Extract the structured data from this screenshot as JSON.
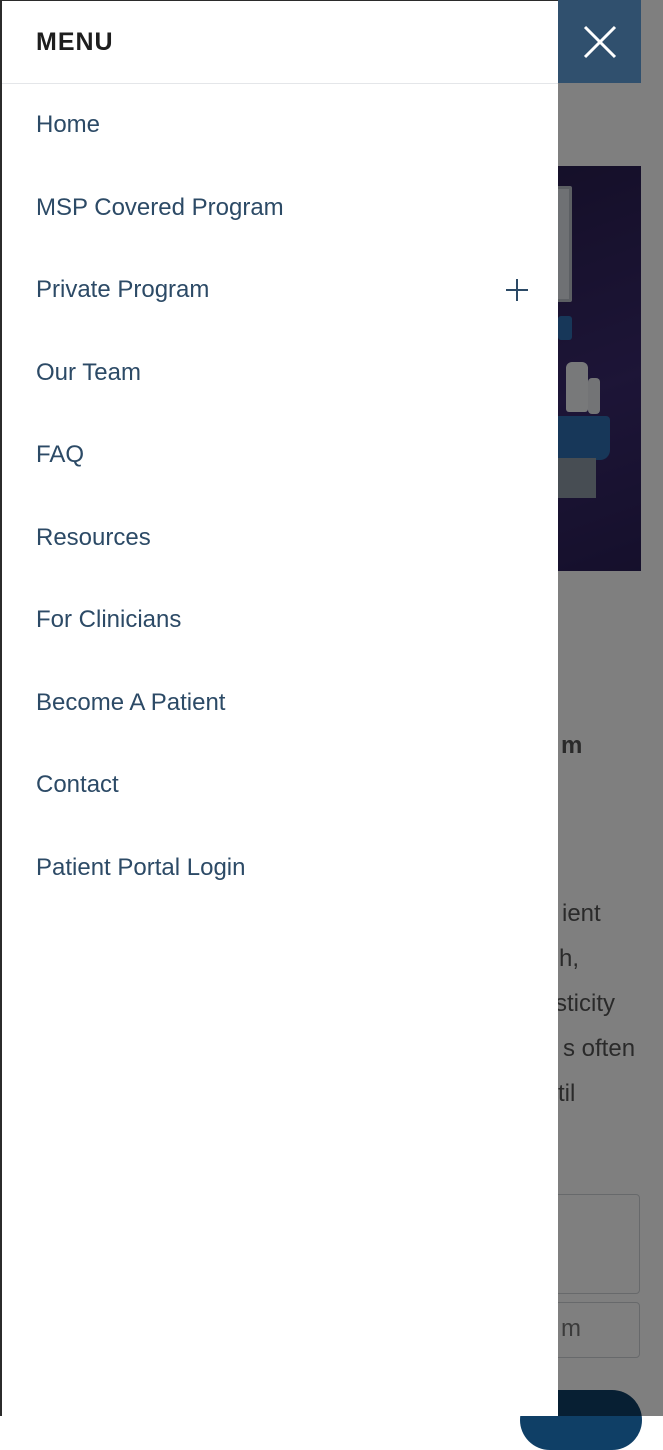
{
  "menu": {
    "title": "MENU",
    "items": [
      {
        "label": "Home"
      },
      {
        "label": "MSP Covered Program"
      },
      {
        "label": "Private Program",
        "expandable": true
      },
      {
        "label": "Our Team"
      },
      {
        "label": "FAQ"
      },
      {
        "label": "Resources"
      },
      {
        "label": "For Clinicians"
      },
      {
        "label": "Become A Patient"
      },
      {
        "label": "Contact"
      },
      {
        "label": "Patient Portal Login"
      }
    ]
  },
  "close_button": {
    "icon": "close-icon"
  },
  "background": {
    "heading_fragment": "m",
    "text_fragments": [
      "ient",
      "h,",
      "sticity",
      "s often",
      "til"
    ],
    "input_fragment": "m"
  },
  "colors": {
    "menu_text": "#2c4a66",
    "close_button_bg": "#30506e",
    "hero_bg": "#2a1f52",
    "cta_button_bg": "#0f3f66"
  }
}
